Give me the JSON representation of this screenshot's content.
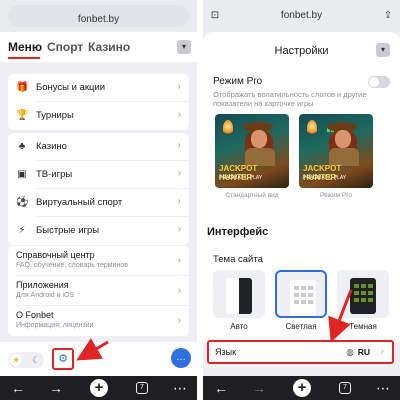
{
  "left": {
    "url": "fonbet.by",
    "tabs": [
      {
        "label": "Меню",
        "active": true
      },
      {
        "label": "Спорт",
        "active": false
      },
      {
        "label": "Казино",
        "active": false
      }
    ],
    "group1": [
      {
        "icon": "gift-icon",
        "glyph": "🎁",
        "label": "Бонусы и акции"
      },
      {
        "icon": "trophy-icon",
        "glyph": "🏆",
        "label": "Турниры"
      }
    ],
    "group2": [
      {
        "icon": "casino-icon",
        "glyph": "♣",
        "label": "Казино"
      },
      {
        "icon": "tv-icon",
        "glyph": "▣",
        "label": "ТВ-игры"
      },
      {
        "icon": "virtual-sport-icon",
        "glyph": "⚽",
        "label": "Виртуальный спорт"
      },
      {
        "icon": "fast-games-icon",
        "glyph": "⚡",
        "label": "Быстрые игры"
      }
    ],
    "group3": [
      {
        "label": "Справочный центр",
        "sub": "FAQ, обучение, словарь терминов"
      },
      {
        "label": "Приложения",
        "sub": "Для Android и iOS"
      },
      {
        "label": "О Fonbet",
        "sub": "Информация, лицензии"
      }
    ],
    "tabs_count": "7"
  },
  "right": {
    "url": "fonbet.by",
    "title": "Настройки",
    "pro": {
      "title": "Режим Pro",
      "desc": "Отображать волатильность слотов и другие показатели на карточке игры",
      "enabled": false,
      "games": [
        {
          "title": "JACKPOT HUNTER",
          "sub": "PRAGMATIC PLAY",
          "caption": "Стандартный вид"
        },
        {
          "title": "JACKPOT HUNTER",
          "sub": "PRAGMATIC PLAY",
          "caption": "Режим Pro"
        }
      ]
    },
    "interface": {
      "title": "Интерфейс",
      "theme_label": "Тема сайта",
      "themes": [
        {
          "label": "Авто",
          "selected": false
        },
        {
          "label": "Светлая",
          "selected": true
        },
        {
          "label": "Темная",
          "selected": false
        }
      ]
    },
    "language": {
      "label": "Язык",
      "value": "RU"
    },
    "tabs_count": "7"
  },
  "colors": {
    "accent_red": "#e02424",
    "accent_blue": "#2f6fe0",
    "browser_bar": "#1f1f21"
  }
}
